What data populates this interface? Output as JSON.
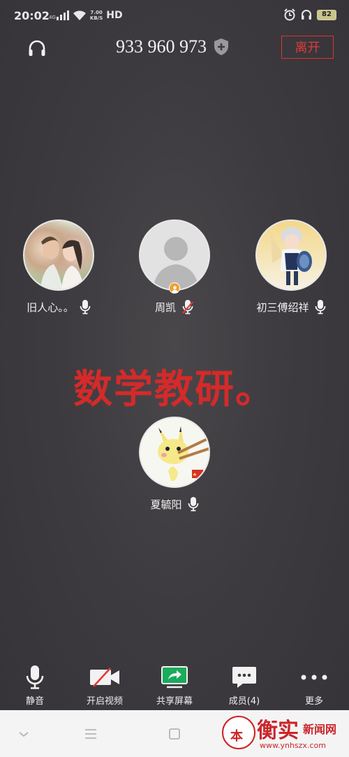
{
  "status_bar": {
    "time": "20:02",
    "network": "4G",
    "speed_value": "7.00",
    "speed_unit": "KB/S",
    "hd": "HD",
    "battery": "82"
  },
  "meeting": {
    "id": "933 960 973",
    "leave_label": "离开"
  },
  "participants": [
    {
      "name": "旧人心。。",
      "mic": "on",
      "avatar": "couple-photo"
    },
    {
      "name": "周凯",
      "mic": "muted",
      "avatar": "default-person",
      "host": true
    },
    {
      "name": "初三傅绍祥",
      "mic": "on",
      "avatar": "anime-character"
    },
    {
      "name": "夏毓阳",
      "mic": "on",
      "avatar": "pikachu-sticker"
    }
  ],
  "headline": "数学教研。",
  "toolbar": {
    "mute_label": "静音",
    "video_label": "开启视频",
    "share_label": "共享屏幕",
    "members_label": "成员(4)",
    "more_label": "更多"
  },
  "watermark": {
    "logo_text": "本",
    "title": "衡实",
    "subtitle": "新闻网",
    "url": "www.ynhszx.com"
  },
  "colors": {
    "accent_red": "#e23a3a",
    "share_green": "#1aab5b",
    "host_orange": "#f0a030"
  }
}
